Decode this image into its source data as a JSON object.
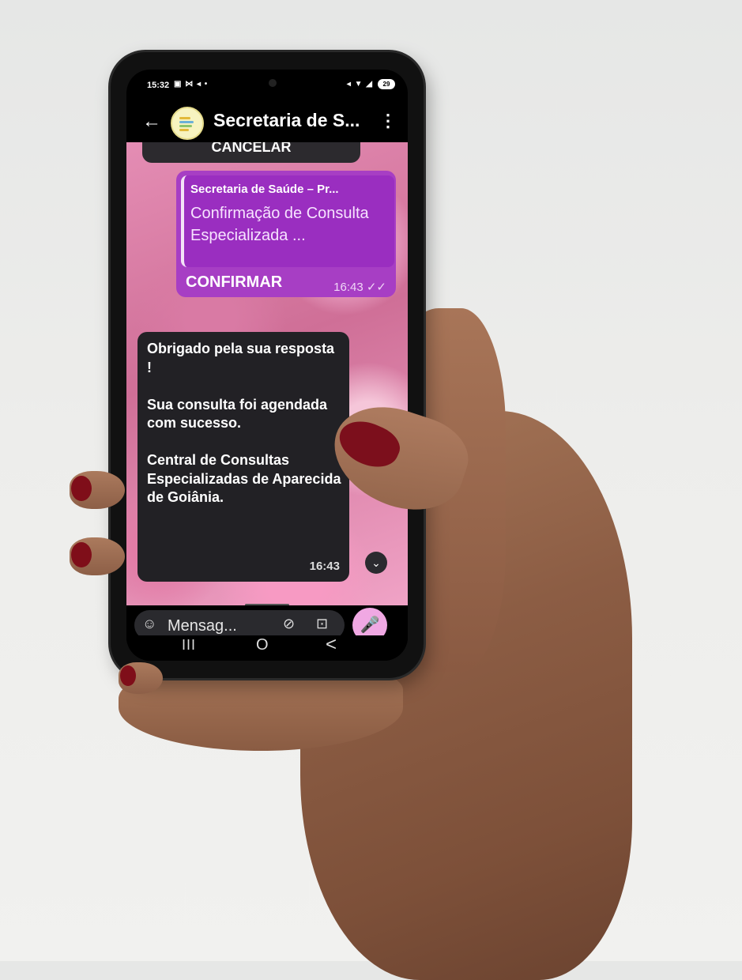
{
  "status_bar": {
    "time": "15:32",
    "left_icons": "▣ ⋈ ◂ •",
    "right_icons": "◂ ▼ ◢",
    "battery": "29"
  },
  "header": {
    "title": "Secretaria de S...",
    "back_icon": "back-arrow-icon",
    "menu_icon": "more-vert-icon"
  },
  "chat": {
    "previous_button_label": "CANCELAR",
    "sent_message": {
      "quoted_sender": "Secretaria de Saúde – Pr...",
      "quoted_text": "Confirmação de Consulta Especializada ...",
      "reply_text": "CONFIRMAR",
      "time": "16:43 ✓✓"
    },
    "received_message": {
      "text": "Obrigado pela sua resposta !\n\nSua consulta foi agendada com sucesso.\n\nCentral de Consultas Especializadas de Aparecida de Goiânia.",
      "time": "16:43"
    }
  },
  "input": {
    "placeholder": "Mensag...",
    "emoji_icon": "emoji-icon",
    "attach_icon": "paperclip-icon",
    "camera_icon": "camera-icon",
    "mic_icon": "microphone-icon"
  },
  "nav": {
    "recent": "III",
    "home": "O",
    "back": "<"
  },
  "colors": {
    "sent_bubble": "#a73ec4",
    "received_bubble": "#222125",
    "mic_button": "#f0a8e3",
    "nail_polish": "#7f0e19"
  }
}
